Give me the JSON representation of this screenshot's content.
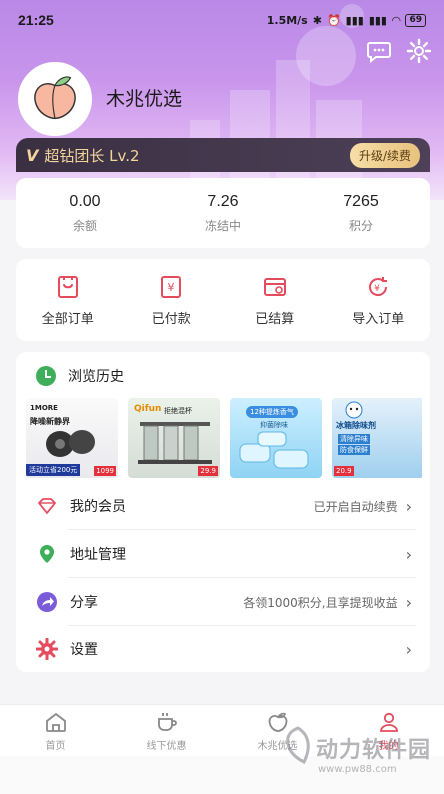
{
  "status": {
    "time": "21:25",
    "speed": "1.5M/s",
    "signal1": "4G",
    "signal2": "4G",
    "battery": "69"
  },
  "profile": {
    "username": "木兆优选",
    "level_badge": "超钻团长 Lv.2",
    "upgrade_label": "升级/续费"
  },
  "stats": [
    {
      "value": "0.00",
      "label": "余额"
    },
    {
      "value": "7.26",
      "label": "冻结中"
    },
    {
      "value": "7265",
      "label": "积分"
    }
  ],
  "orders": [
    {
      "label": "全部订单",
      "icon": "all-orders-icon"
    },
    {
      "label": "已付款",
      "icon": "paid-icon"
    },
    {
      "label": "已结算",
      "icon": "settled-icon"
    },
    {
      "label": "导入订单",
      "icon": "import-order-icon"
    }
  ],
  "history": {
    "title": "浏览历史",
    "items": [
      {
        "line1": "1MORE",
        "line2": "降噪新静界",
        "line3": "活动立省200元",
        "price": "1099"
      },
      {
        "line1": "Qifun",
        "line2": "拒绝混杯",
        "price": "29.9"
      },
      {
        "line1": "12种提炼香气",
        "line2": "抑菌除味"
      },
      {
        "line1": "冰箱除味剂",
        "line2": "清除异味",
        "line3": "防食保鲜",
        "price": "20.9"
      }
    ]
  },
  "menu": [
    {
      "label": "我的会员",
      "extra": "已开启自动续费",
      "icon": "diamond-icon"
    },
    {
      "label": "地址管理",
      "extra": "",
      "icon": "location-icon"
    },
    {
      "label": "分享",
      "extra": "各领1000积分,且享提现收益",
      "icon": "share-icon"
    },
    {
      "label": "设置",
      "extra": "",
      "icon": "gear-icon"
    }
  ],
  "tabs": [
    {
      "label": "首页",
      "active": false
    },
    {
      "label": "线下优惠",
      "active": false
    },
    {
      "label": "木兆优选",
      "active": false
    },
    {
      "label": "我的",
      "active": true
    }
  ],
  "watermark": {
    "text": "动力软件园",
    "url": "www.pw88.com"
  },
  "colors": {
    "accent": "#e44b5d",
    "hero_top": "#b889e6",
    "vip_gold": "#f2d69c",
    "history_green": "#3fae5a"
  }
}
